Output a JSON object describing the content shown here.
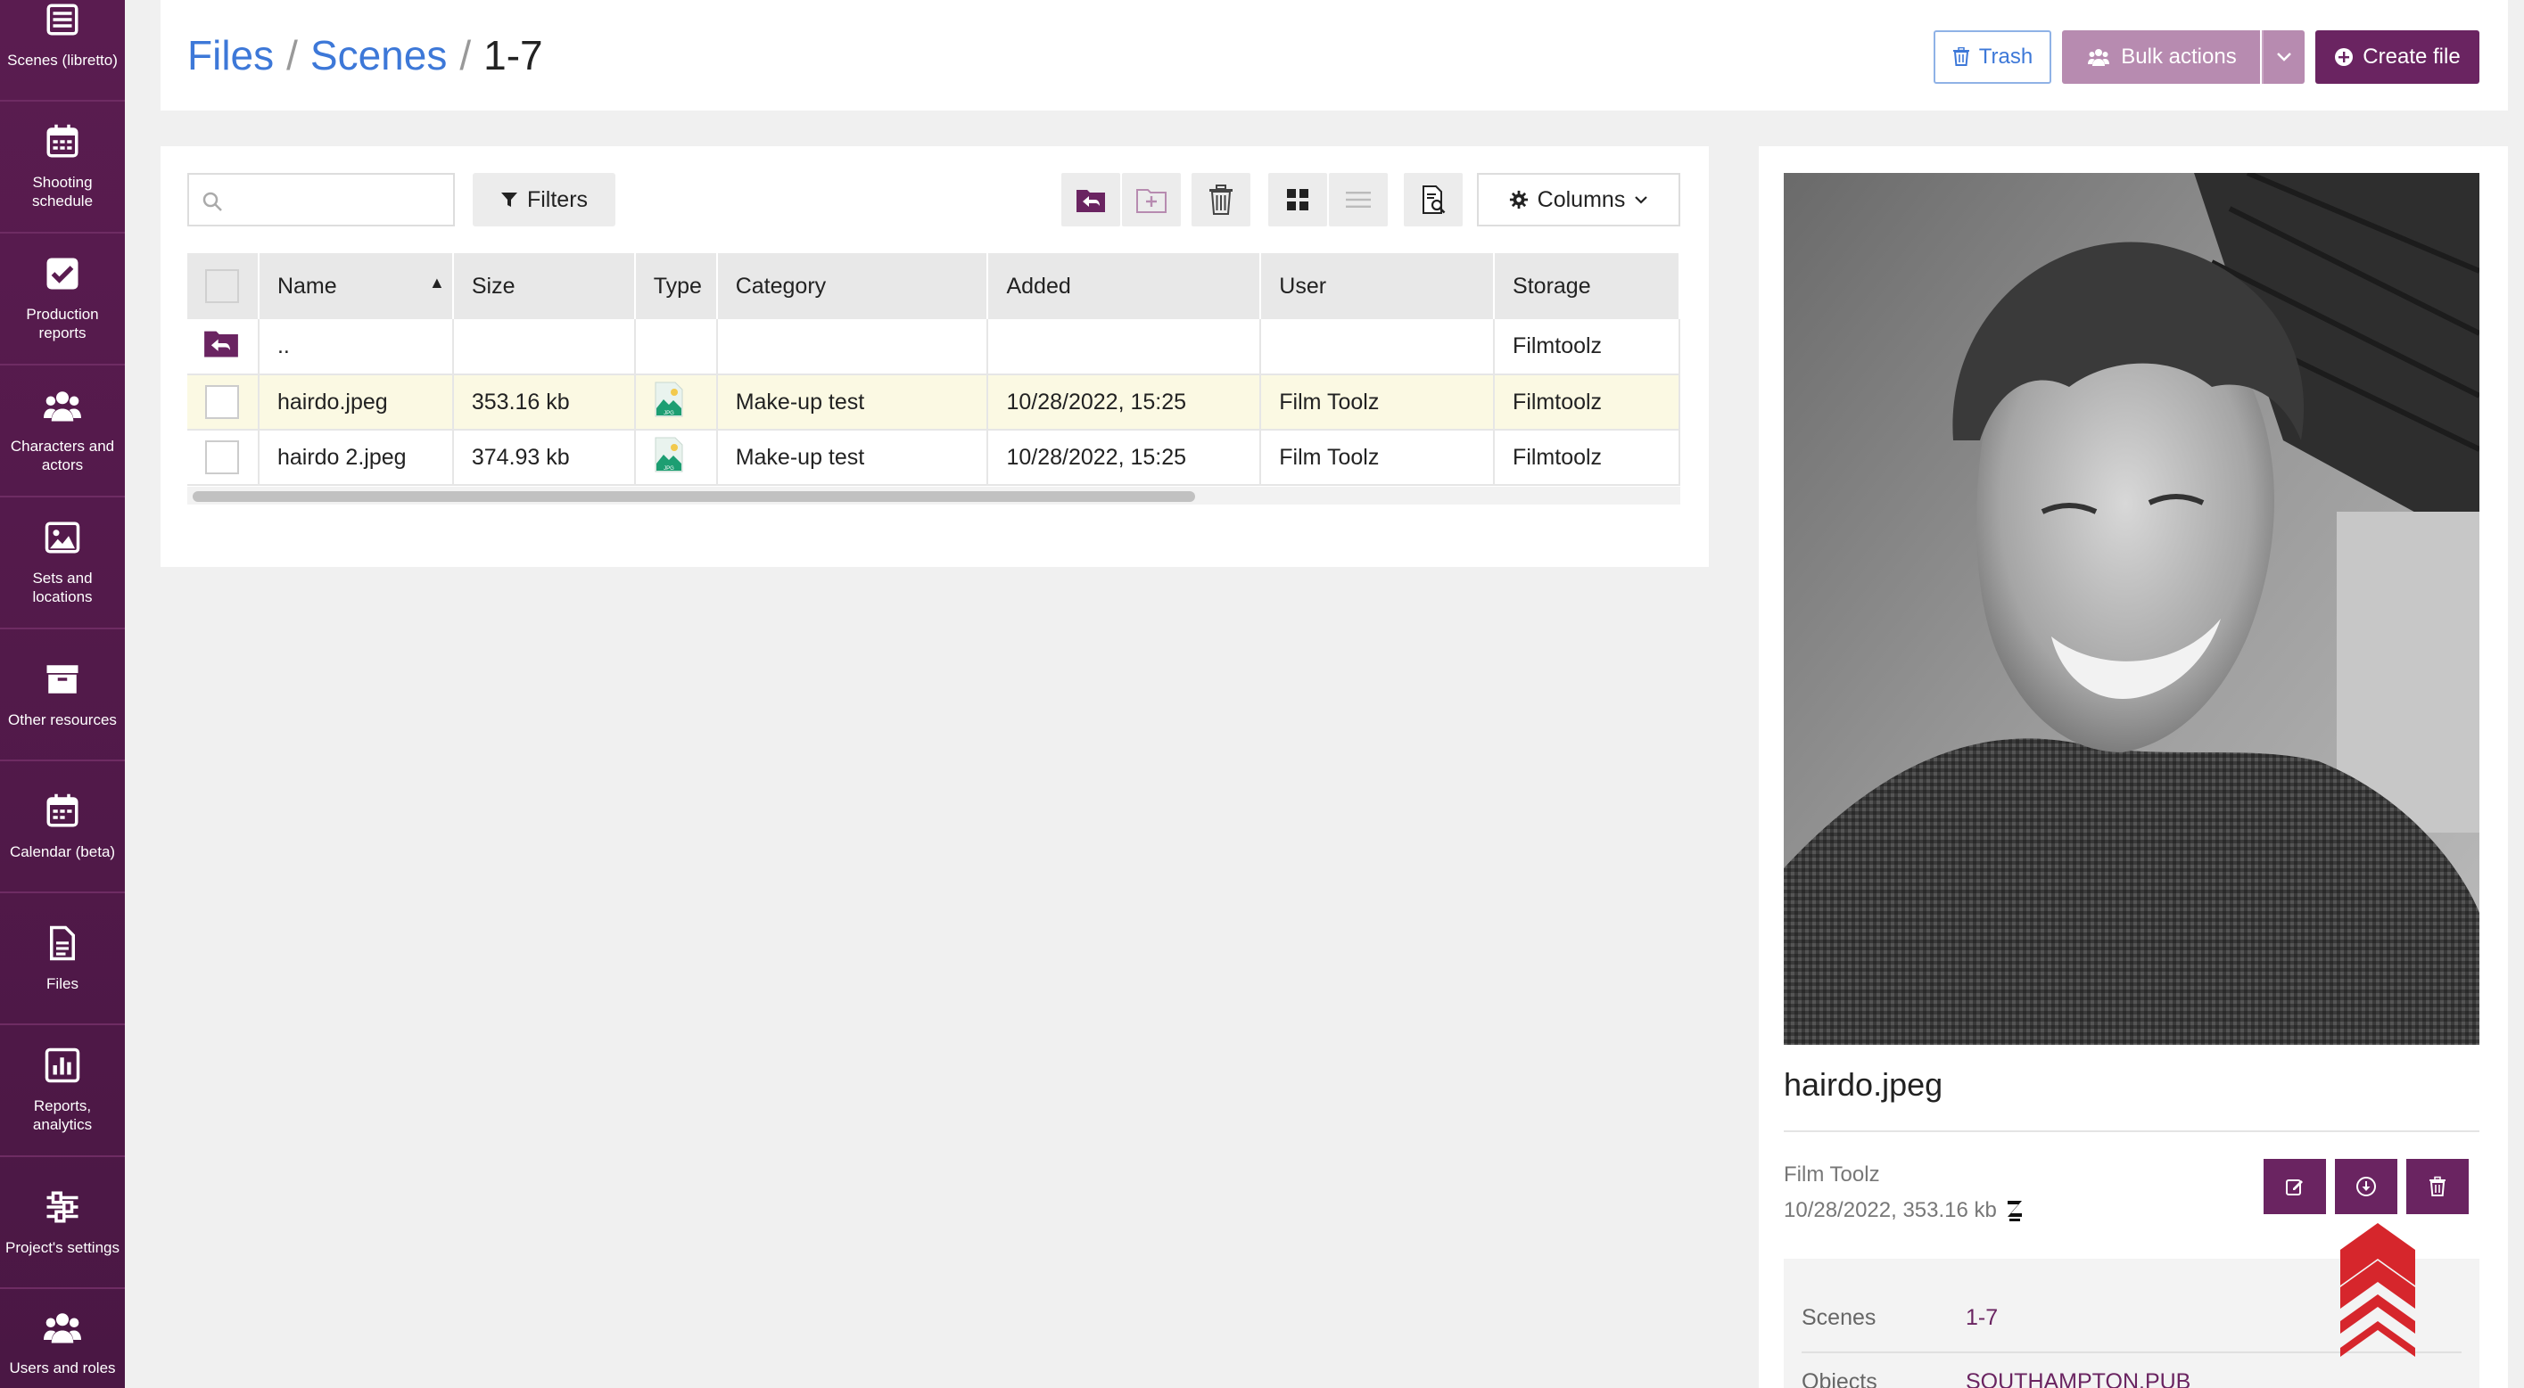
{
  "sidebar": {
    "items": [
      {
        "label": "Scenes (libretto)",
        "icon": "list-icon"
      },
      {
        "label": "Shooting schedule",
        "icon": "calendar-icon"
      },
      {
        "label": "Production reports",
        "icon": "check-square-icon"
      },
      {
        "label": "Characters and actors",
        "icon": "users-icon"
      },
      {
        "label": "Sets and locations",
        "icon": "image-icon"
      },
      {
        "label": "Other resources",
        "icon": "archive-icon"
      },
      {
        "label": "Calendar (beta)",
        "icon": "calendar-icon"
      },
      {
        "label": "Files",
        "icon": "file-icon"
      },
      {
        "label": "Reports, analytics",
        "icon": "bar-chart-icon"
      },
      {
        "label": "Project's settings",
        "icon": "sliders-icon"
      },
      {
        "label": "Users and roles",
        "icon": "users-icon"
      }
    ]
  },
  "header": {
    "breadcrumb": [
      "Files",
      "Scenes",
      "1-7"
    ],
    "separator": "/",
    "trash_label": "Trash",
    "bulk_label": "Bulk actions",
    "create_label": "Create file"
  },
  "toolbar": {
    "search_placeholder": "",
    "filters_label": "Filters",
    "columns_label": "Columns"
  },
  "table": {
    "columns": [
      "Name",
      "Size",
      "Type",
      "Category",
      "Added",
      "User",
      "Storage"
    ],
    "parent_row": {
      "name": "..",
      "storage": "Filmtoolz"
    },
    "rows": [
      {
        "name": "hairdo.jpeg",
        "size": "353.16 kb",
        "type": "JPG",
        "category": "Make-up test",
        "added": "10/28/2022, 15:25",
        "user": "Film Toolz",
        "storage": "Filmtoolz",
        "highlighted": true
      },
      {
        "name": "hairdo 2.jpeg",
        "size": "374.93 kb",
        "type": "JPG",
        "category": "Make-up test",
        "added": "10/28/2022, 15:25",
        "user": "Film Toolz",
        "storage": "Filmtoolz",
        "highlighted": false
      }
    ]
  },
  "preview": {
    "title": "hairdo.jpeg",
    "user": "Film Toolz",
    "date_size": "10/28/2022, 353.16 kb",
    "info": [
      {
        "key": "Scenes",
        "value": "1-7"
      },
      {
        "key": "Objects",
        "value": "SOUTHAMPTON.PUB"
      }
    ]
  },
  "colors": {
    "sidebar": "#5a1c50",
    "accent": "#6a2461",
    "link": "#3d78d8",
    "highlight_row": "#fbf9e3",
    "scroll_top": "#d6262c"
  }
}
